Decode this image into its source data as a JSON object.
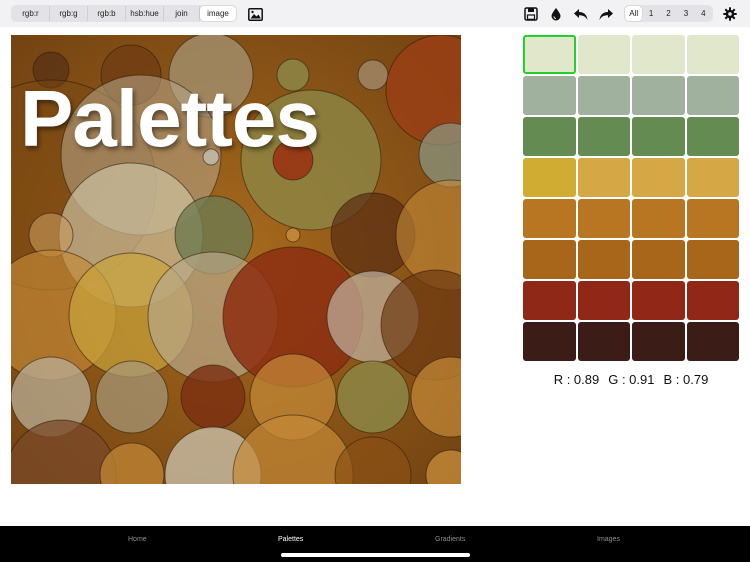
{
  "toolbar": {
    "segments": [
      {
        "label": "rgb:r",
        "active": false
      },
      {
        "label": "rgb:g",
        "active": false
      },
      {
        "label": "rgb:b",
        "active": false
      },
      {
        "label": "hsb:hue",
        "active": false
      },
      {
        "label": "join",
        "active": false
      },
      {
        "label": "image",
        "active": true
      }
    ],
    "icons": [
      "photo-icon",
      "save-icon",
      "drop-icon",
      "undo-icon",
      "redo-icon",
      "gear-icon"
    ],
    "count_options": [
      {
        "label": "All",
        "active": true
      },
      {
        "label": "1",
        "active": false
      },
      {
        "label": "2",
        "active": false
      },
      {
        "label": "3",
        "active": false
      },
      {
        "label": "4",
        "active": false
      }
    ]
  },
  "image": {
    "title": "Palettes"
  },
  "palette": {
    "rows": [
      [
        "#e1e7cb",
        "#e1e7cb",
        "#e1e7cb",
        "#e1e7cb"
      ],
      [
        "#a0b29e",
        "#a0b29e",
        "#a0b29e",
        "#a0b29e"
      ],
      [
        "#648b52",
        "#648b52",
        "#648b52",
        "#648b52"
      ],
      [
        "#d0ad32",
        "#d5a745",
        "#d5a745",
        "#d5a745"
      ],
      [
        "#b87522",
        "#b87522",
        "#b87522",
        "#b87522"
      ],
      [
        "#a7661a",
        "#a7661a",
        "#a7661a",
        "#a7661a"
      ],
      [
        "#8f2817",
        "#912817",
        "#912817",
        "#912817"
      ],
      [
        "#3c1c16",
        "#3c1c16",
        "#3c1c16",
        "#3c1c16"
      ]
    ],
    "selected": [
      0,
      0
    ],
    "selected_color": "#22d22a"
  },
  "readout": {
    "r": "R : 0.89",
    "g": "G : 0.91",
    "b": "B : 0.79"
  },
  "tabs": [
    {
      "label": "Home",
      "active": false
    },
    {
      "label": "Palettes",
      "active": true
    },
    {
      "label": "Gradients",
      "active": false
    },
    {
      "label": "Images",
      "active": false
    }
  ]
}
